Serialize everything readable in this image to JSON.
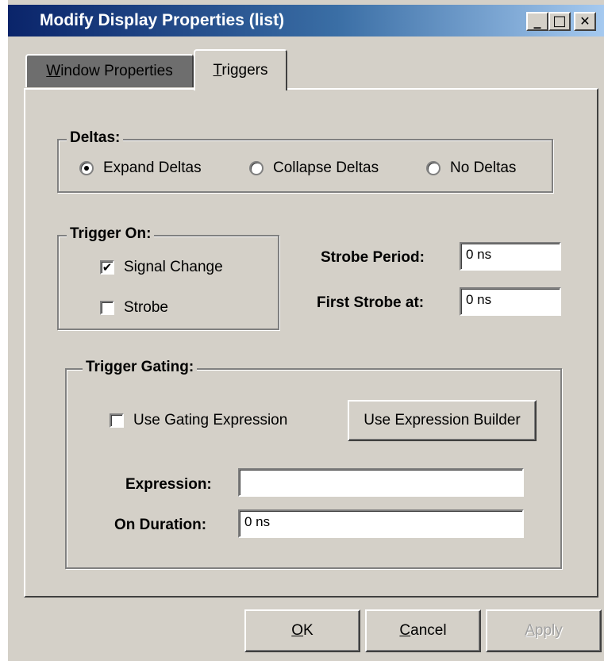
{
  "window": {
    "title": "Modify Display Properties (list)"
  },
  "titlebar_buttons": {
    "minimize": "_",
    "maximize": "□",
    "close": "✕"
  },
  "tabs": [
    {
      "label_u": "W",
      "label_rest": "indow Properties",
      "active": false
    },
    {
      "label_u": "T",
      "label_rest": "riggers",
      "active": true
    }
  ],
  "deltas": {
    "legend": "Deltas:",
    "options": [
      {
        "label": "Expand Deltas",
        "checked": true
      },
      {
        "label": "Collapse Deltas",
        "checked": false
      },
      {
        "label": "No Deltas",
        "checked": false
      }
    ]
  },
  "trigger_on": {
    "legend": "Trigger On:",
    "signal_change": {
      "label": "Signal Change",
      "checked": true
    },
    "strobe": {
      "label": "Strobe",
      "checked": false
    }
  },
  "strobe": {
    "period_label": "Strobe Period:",
    "period_value": "0 ns",
    "first_label": "First Strobe at:",
    "first_value": "0 ns"
  },
  "gating": {
    "legend": "Trigger Gating:",
    "use_gating": {
      "label": "Use Gating Expression",
      "checked": false
    },
    "builder_button": "Use Expression Builder",
    "expression_label": "Expression:",
    "expression_value": "",
    "duration_label": "On Duration:",
    "duration_value": "0 ns"
  },
  "buttons": {
    "ok_u": "O",
    "ok_rest": "K",
    "cancel_u": "C",
    "cancel_rest": "ancel",
    "apply_u": "A",
    "apply_rest": "pply"
  },
  "check_glyph": "✔"
}
